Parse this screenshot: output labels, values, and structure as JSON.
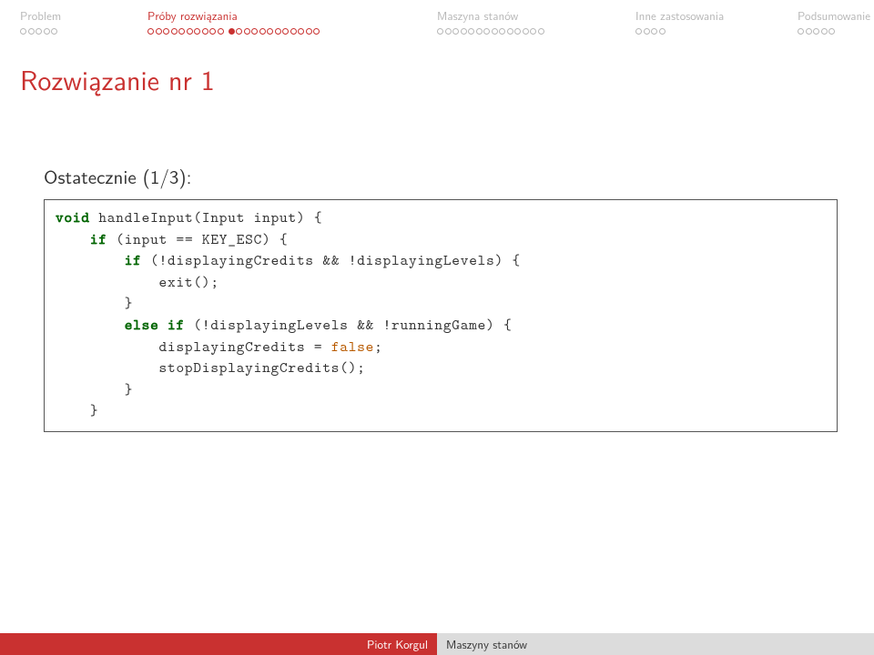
{
  "nav": {
    "sections": [
      {
        "label": "Problem",
        "active": false,
        "dots": 5,
        "filled": -1,
        "split": 0
      },
      {
        "label": "Próby rozwiązania",
        "active": true,
        "dots": 22,
        "filled": 10,
        "split": 10
      },
      {
        "label": "Maszyna stanów",
        "active": false,
        "dots": 14,
        "filled": -1,
        "split": 0
      },
      {
        "label": "Inne zastosowania",
        "active": false,
        "dots": 4,
        "filled": -1,
        "split": 0
      },
      {
        "label": "Podsumowanie",
        "active": false,
        "dots": 5,
        "filled": -1,
        "split": 0
      }
    ]
  },
  "slide": {
    "title": "Rozwiązanie nr 1",
    "subtitle": "Ostatecznie (1/3):"
  },
  "code": {
    "kw_void": "void",
    "fn": " handleInput(Input input) {",
    "if1a": "    ",
    "kw_if1": "if",
    "if1b": " (input == KEY_ESC) {",
    "if2a": "        ",
    "kw_if2": "if",
    "if2b": " (!displayingCredits && !displayingLevels) {",
    "ln_exit": "            exit();",
    "ln_close1": "        }",
    "else_a": "        ",
    "kw_else": "else if",
    "else_b": " (!displayingLevels && !runningGame) {",
    "ln_assign_a": "            displayingCredits = ",
    "kw_false": "false",
    "ln_assign_b": ";",
    "ln_stop": "            stopDisplayingCredits();",
    "ln_close2": "        }",
    "ln_close3": "    }"
  },
  "footer": {
    "author": "Piotr Korgul",
    "presentation": "Maszyny stanów"
  }
}
